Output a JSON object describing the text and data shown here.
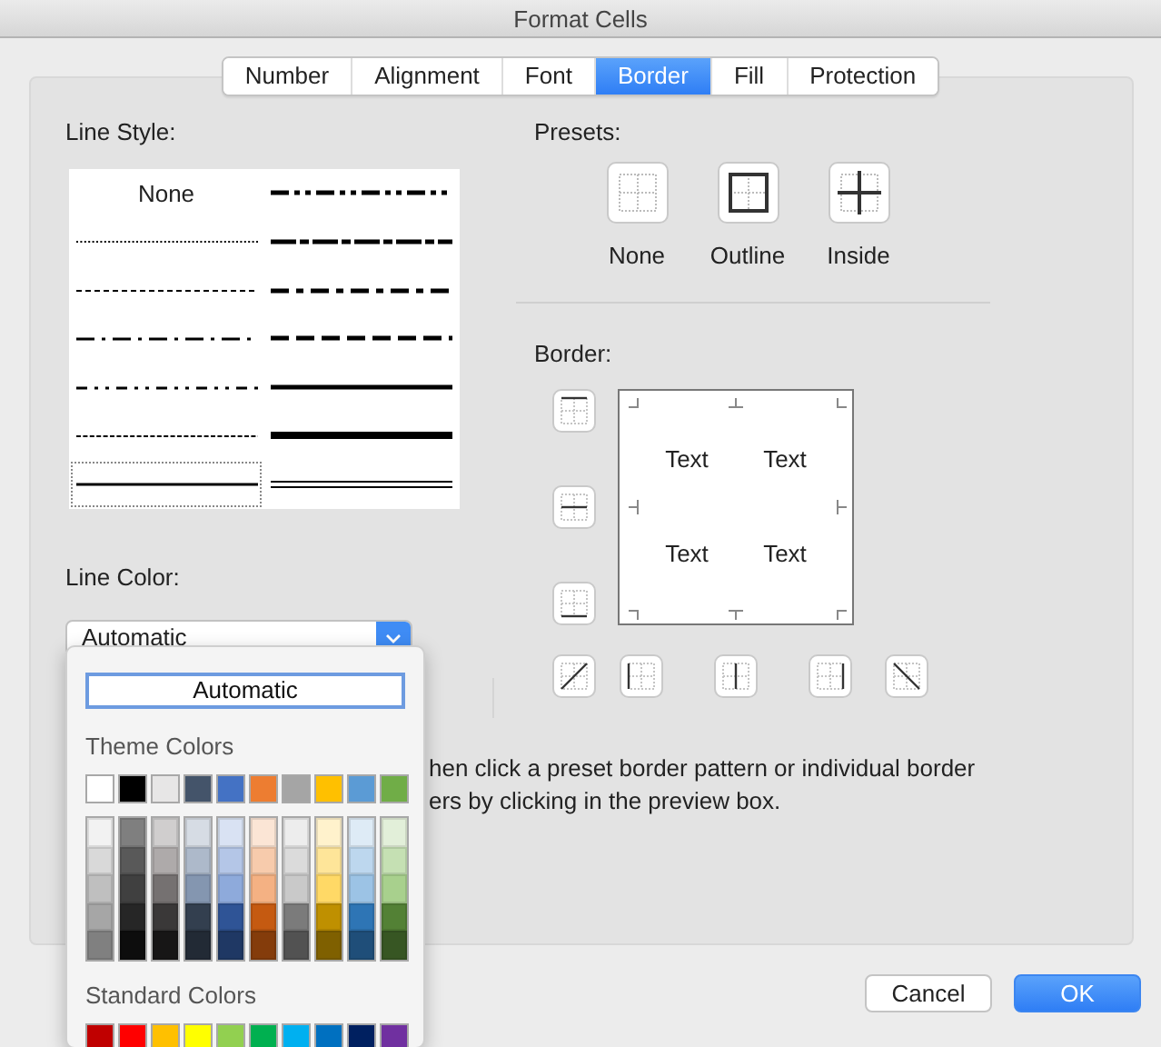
{
  "window": {
    "title": "Format Cells"
  },
  "tabs": [
    {
      "label": "Number",
      "selected": false
    },
    {
      "label": "Alignment",
      "selected": false
    },
    {
      "label": "Font",
      "selected": false
    },
    {
      "label": "Border",
      "selected": true
    },
    {
      "label": "Fill",
      "selected": false
    },
    {
      "label": "Protection",
      "selected": false
    }
  ],
  "line_style": {
    "label": "Line Style:",
    "styles": [
      {
        "kind": "none",
        "label": "None",
        "selected": false
      },
      {
        "kind": "medium-dash-dot-dot",
        "selected": false
      },
      {
        "kind": "dotted",
        "selected": false
      },
      {
        "kind": "slanted-dash-dot",
        "selected": false
      },
      {
        "kind": "dashed-small",
        "selected": false
      },
      {
        "kind": "medium-dash-dot",
        "selected": false
      },
      {
        "kind": "dash-dot",
        "selected": false
      },
      {
        "kind": "medium-dashed",
        "selected": false
      },
      {
        "kind": "dash-dot-dot",
        "selected": false
      },
      {
        "kind": "medium",
        "selected": false
      },
      {
        "kind": "hair-dashed",
        "selected": false
      },
      {
        "kind": "thick",
        "selected": false
      },
      {
        "kind": "thin",
        "selected": true
      },
      {
        "kind": "double",
        "selected": false
      }
    ]
  },
  "line_color": {
    "label": "Line Color:",
    "value": "Automatic",
    "expanded": true
  },
  "color_menu": {
    "automatic_button": "Automatic",
    "theme_heading": "Theme Colors",
    "theme_colors": [
      {
        "color": "#ffffff",
        "shades": [
          {
            "color": "#f2f2f2"
          },
          {
            "color": "#d9d9d9"
          },
          {
            "color": "#bfbfbf"
          },
          {
            "color": "#a6a6a6"
          },
          {
            "color": "#808080"
          }
        ]
      },
      {
        "color": "#000000",
        "shades": [
          {
            "color": "#7f7f7f"
          },
          {
            "color": "#595959"
          },
          {
            "color": "#404040"
          },
          {
            "color": "#262626"
          },
          {
            "color": "#0d0d0d"
          }
        ]
      },
      {
        "color": "#e7e6e6",
        "shades": [
          {
            "color": "#d0cece"
          },
          {
            "color": "#aeaaaa"
          },
          {
            "color": "#757171"
          },
          {
            "color": "#3a3838"
          },
          {
            "color": "#171616"
          }
        ]
      },
      {
        "color": "#44546a",
        "shades": [
          {
            "color": "#d6dce4"
          },
          {
            "color": "#adb9ca"
          },
          {
            "color": "#8496b0"
          },
          {
            "color": "#333f4f"
          },
          {
            "color": "#222a35"
          }
        ]
      },
      {
        "color": "#4472c4",
        "shades": [
          {
            "color": "#d9e2f3"
          },
          {
            "color": "#b4c6e7"
          },
          {
            "color": "#8eaadb"
          },
          {
            "color": "#2f5496"
          },
          {
            "color": "#1f3864"
          }
        ]
      },
      {
        "color": "#ed7d31",
        "shades": [
          {
            "color": "#fbe5d5"
          },
          {
            "color": "#f7cbac"
          },
          {
            "color": "#f4b183"
          },
          {
            "color": "#c55a11"
          },
          {
            "color": "#843c0b"
          }
        ]
      },
      {
        "color": "#a5a5a5",
        "shades": [
          {
            "color": "#ededed"
          },
          {
            "color": "#dbdbdb"
          },
          {
            "color": "#c9c9c9"
          },
          {
            "color": "#7b7b7b"
          },
          {
            "color": "#525252"
          }
        ]
      },
      {
        "color": "#ffc000",
        "shades": [
          {
            "color": "#fff2cc"
          },
          {
            "color": "#fee599"
          },
          {
            "color": "#ffd966"
          },
          {
            "color": "#bf9000"
          },
          {
            "color": "#7f6000"
          }
        ]
      },
      {
        "color": "#5b9bd5",
        "shades": [
          {
            "color": "#deebf6"
          },
          {
            "color": "#bdd7ee"
          },
          {
            "color": "#9cc3e5"
          },
          {
            "color": "#2e75b5"
          },
          {
            "color": "#1f4e79"
          }
        ]
      },
      {
        "color": "#70ad47",
        "shades": [
          {
            "color": "#e2efd9"
          },
          {
            "color": "#c5e0b3"
          },
          {
            "color": "#a8d08d"
          },
          {
            "color": "#538135"
          },
          {
            "color": "#375623"
          }
        ]
      }
    ],
    "standard_heading": "Standard Colors",
    "standard_colors": [
      {
        "color": "#c00000"
      },
      {
        "color": "#ff0000"
      },
      {
        "color": "#ffc000"
      },
      {
        "color": "#ffff00"
      },
      {
        "color": "#92d050"
      },
      {
        "color": "#00b050"
      },
      {
        "color": "#00b0f0"
      },
      {
        "color": "#0070c0"
      },
      {
        "color": "#002060"
      },
      {
        "color": "#7030a0"
      }
    ]
  },
  "presets": {
    "label": "Presets:",
    "items": [
      {
        "kind": "none",
        "label": "None"
      },
      {
        "kind": "outline",
        "label": "Outline"
      },
      {
        "kind": "inside",
        "label": "Inside"
      }
    ]
  },
  "border": {
    "label": "Border:",
    "side_buttons": [
      {
        "kind": "top"
      },
      {
        "kind": "middle"
      },
      {
        "kind": "bottom"
      }
    ],
    "bottom_buttons": [
      {
        "kind": "diagonal-up"
      },
      {
        "kind": "left"
      },
      {
        "kind": "center"
      },
      {
        "kind": "right"
      },
      {
        "kind": "diagonal-down"
      }
    ],
    "preview_texts": [
      "Text",
      "Text",
      "Text",
      "Text"
    ]
  },
  "help_text": [
    "hen click a preset border pattern or individual border",
    "ers by clicking in the preview box."
  ],
  "buttons": [
    {
      "label": "Cancel",
      "kind": "secondary"
    },
    {
      "label": "OK",
      "kind": "default"
    }
  ]
}
